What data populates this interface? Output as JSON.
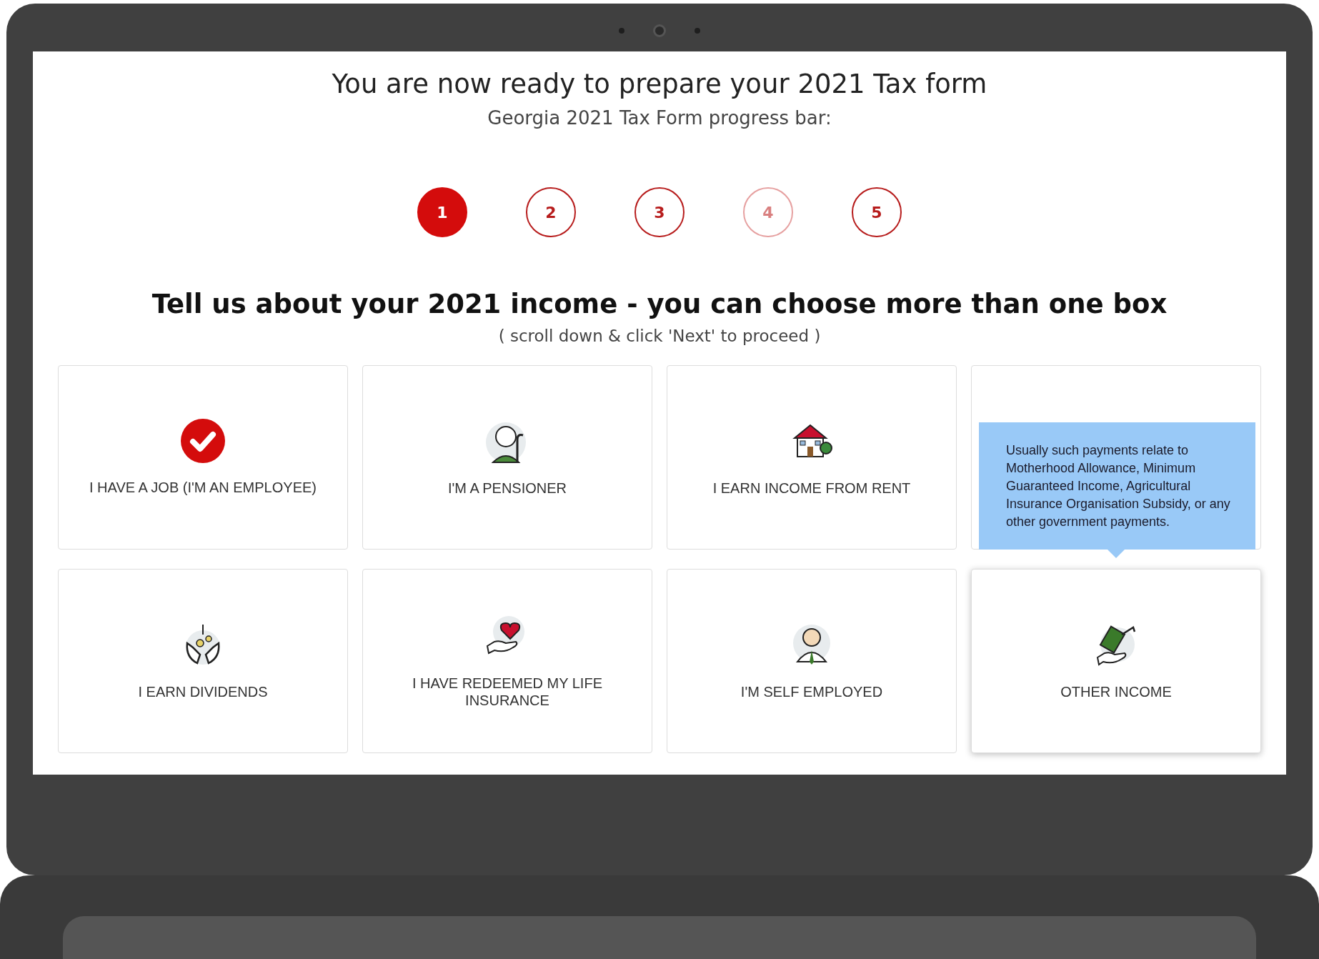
{
  "title": "You are now ready to prepare your 2021 Tax form",
  "subtitle": "Georgia 2021 Tax Form progress bar:",
  "steps": [
    {
      "label": "1",
      "selected": true,
      "disabled": false
    },
    {
      "label": "2",
      "selected": false,
      "disabled": false
    },
    {
      "label": "3",
      "selected": false,
      "disabled": false
    },
    {
      "label": "4",
      "selected": false,
      "disabled": true
    },
    {
      "label": "5",
      "selected": false,
      "disabled": false
    }
  ],
  "question": "Tell us about your 2021 income - you can choose more than one box",
  "hint": "( scroll down & click 'Next' to proceed )",
  "cards": [
    {
      "label": "I HAVE A JOB (I'M AN EMPLOYEE)",
      "selected": true,
      "hovered": false
    },
    {
      "kind": "pensioner",
      "label": "I'M A PENSIONER",
      "selected": false,
      "hovered": false
    },
    {
      "kind": "rent",
      "label": "I EARN INCOME FROM RENT",
      "selected": false,
      "hovered": false
    },
    {
      "kind": "blank",
      "hovered": false
    },
    {
      "kind": "dividends",
      "label": "I EARN DIVIDENDS",
      "selected": false,
      "hovered": false
    },
    {
      "kind": "insurance",
      "label": "I HAVE REDEEMED MY LIFE INSURANCE",
      "selected": false,
      "hovered": false
    },
    {
      "kind": "self",
      "label": "I'M SELF EMPLOYED",
      "selected": false,
      "hovered": false
    },
    {
      "kind": "other",
      "label": "OTHER INCOME",
      "selected": false,
      "hovered": true,
      "tooltip": "Usually such payments relate to Motherhood Allowance, Minimum Guaranteed Income, Agricultural Insurance Organisation Subsidy, or any other government payments."
    }
  ]
}
